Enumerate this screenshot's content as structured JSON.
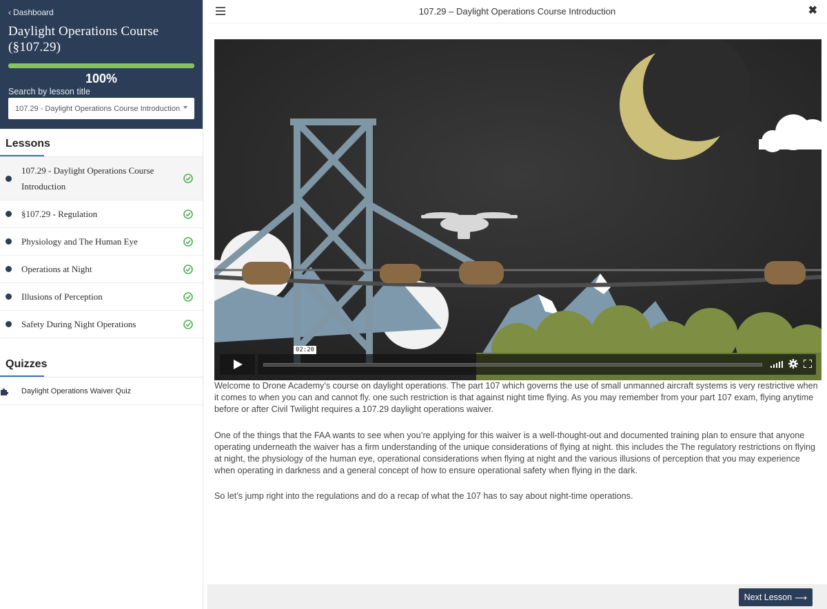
{
  "sidebar": {
    "back_label": "Dashboard",
    "course_title": "Daylight Operations Course (§107.29)",
    "progress_label": "100%",
    "progress_fraction": 1.0,
    "search_label": "Search by lesson title",
    "selected_lesson": "107.29 - Daylight Operations Course Introduction",
    "lessons_heading": "Lessons",
    "lessons": [
      {
        "label": "107.29 - Daylight Operations Course Introduction",
        "completed": true
      },
      {
        "label": "§107.29 - Regulation",
        "completed": true
      },
      {
        "label": "Physiology and The Human Eye",
        "completed": true
      },
      {
        "label": "Operations at Night",
        "completed": true
      },
      {
        "label": "Illusions of Perception",
        "completed": true
      },
      {
        "label": "Safety During Night Operations",
        "completed": true
      }
    ],
    "quizzes_heading": "Quizzes",
    "quizzes": [
      {
        "label": "Daylight Operations Waiver Quiz"
      }
    ]
  },
  "topbar": {
    "title": "107.29 – Daylight Operations Course Introduction",
    "close_icon": "close-icon",
    "menu_icon": "hamburger-icon"
  },
  "video": {
    "time_label": "02:20"
  },
  "content": {
    "paragraphs": [
      "Welcome to Drone Academy’s course on daylight operations.  The part 107 which governs the use of small unmanned aircraft systems is very restrictive when it comes to when you can and cannot fly. one such restriction is that against night time flying. As you may remember from your part 107 exam, flying anytime before or after Civil Twilight requires a 107.29 daylight operations waiver.",
      "One of the things that the FAA wants to see when you’re applying for this waiver is a well-thought-out and documented training plan to ensure that anyone operating underneath the waiver has a firm understanding of the unique considerations of flying at night. this includes the The regulatory restrictions on flying at night, the physiology of the human eye,   operational considerations when flying at night and the various illusions of perception that you may experience when operating in darkness and a general concept of how to ensure operational safety when flying in the dark.",
      "So let’s jump right into the regulations and do a recap of what the 107 has to say about night-time operations."
    ]
  },
  "footer": {
    "next_label": "Next Lesson"
  },
  "colors": {
    "sidebar_header": "#2c3e57",
    "progress": "#86c55a",
    "check": "#4caf50",
    "accent": "#3b6fb6"
  }
}
